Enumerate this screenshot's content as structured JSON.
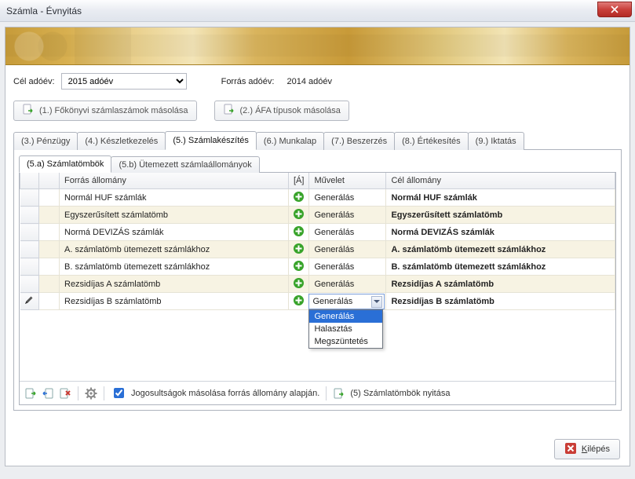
{
  "window": {
    "title": "Számla - Évnyitás"
  },
  "year": {
    "cel_label": "Cél adóév:",
    "cel_value": "2015 adóév",
    "forras_label": "Forrás adóév:",
    "forras_value": "2014 adóév"
  },
  "copy_buttons": {
    "btn1": "(1.) Főkönyvi számlaszámok másolása",
    "btn2": "(2.) ÁFA típusok másolása"
  },
  "main_tabs": [
    "(3.) Pénzügy",
    "(4.) Készletkezelés",
    "(5.) Számlakészítés",
    "(6.) Munkalap",
    "(7.) Beszerzés",
    "(8.) Értékesítés",
    "(9.) Iktatás"
  ],
  "main_tab_active_index": 2,
  "sub_tabs": [
    "(5.a) Számlatömbök",
    "(5.b) Ütemezett számlaállományok"
  ],
  "sub_tab_active_index": 0,
  "grid": {
    "headers": {
      "forras": "Forrás állomány",
      "a": "[Á]",
      "muvelet": "Művelet",
      "cel": "Cél állomány"
    },
    "rows": [
      {
        "forras": "Normál HUF számlák",
        "muvelet": "Generálás",
        "cel": "Normál HUF számlák"
      },
      {
        "forras": "Egyszerűsített számlatömb",
        "muvelet": "Generálás",
        "cel": "Egyszerűsített számlatömb"
      },
      {
        "forras": "Normá DEVIZÁS számlák",
        "muvelet": "Generálás",
        "cel": "Normá DEVIZÁS számlák"
      },
      {
        "forras": "A. számlatömb ütemezett számlákhoz",
        "muvelet": "Generálás",
        "cel": "A. számlatömb ütemezett számlákhoz"
      },
      {
        "forras": "B. számlatömb ütemezett számlákhoz",
        "muvelet": "Generálás",
        "cel": "B. számlatömb ütemezett számlákhoz"
      },
      {
        "forras": "Rezsidíjas A számlatömb",
        "muvelet": "Generálás",
        "cel": "Rezsidíjas A számlatömb"
      },
      {
        "forras": "Rezsidíjas B számlatömb",
        "muvelet": "Generálás",
        "cel": "Rezsidíjas B számlatömb"
      }
    ],
    "editing_row_index": 6,
    "dropdown_options": [
      "Generálás",
      "Halasztás",
      "Megszüntetés"
    ],
    "dropdown_selected_index": 0
  },
  "toolbar": {
    "rights_label": "Jogosultságok másolása forrás állomány alapján.",
    "rights_checked": true,
    "open_label": "(5) Számlatömbök nyitása"
  },
  "footer": {
    "exit_label": "Kilépés"
  },
  "icons": {
    "plus": "plus-circle",
    "doc_arrow": "document-arrow",
    "pencil": "pencil",
    "add_recip": "arrow-right-green",
    "add_sender": "arrow-left-blue",
    "delete": "delete-red",
    "gear": "gear",
    "close_red": "close-red-square"
  },
  "colors": {
    "green": "#38a32a",
    "red": "#c93d36",
    "blue": "#2a6fd6",
    "gold": "#c69b3a"
  }
}
